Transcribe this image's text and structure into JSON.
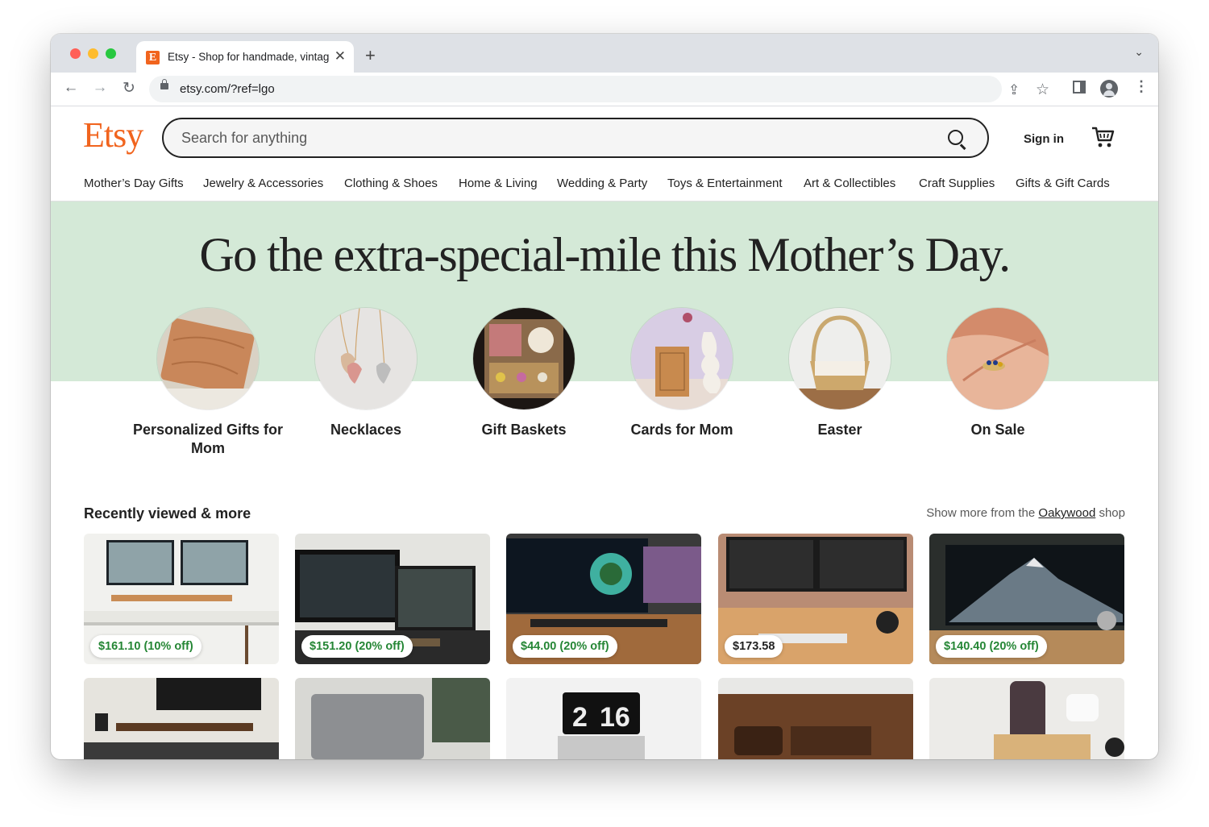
{
  "browser": {
    "tab_title": "Etsy - Shop for handmade, vintage",
    "favicon": "E",
    "url": "etsy.com/?ref=lgo"
  },
  "header": {
    "logo": "Etsy",
    "search_placeholder": "Search for anything",
    "sign_in": "Sign in"
  },
  "categories": [
    "Mother’s Day Gifts",
    "Jewelry & Accessories",
    "Clothing & Shoes",
    "Home & Living",
    "Wedding & Party",
    "Toys & Entertainment",
    "Art & Collectibles",
    "Craft Supplies",
    "Gifts & Gift Cards"
  ],
  "hero": {
    "title": "Go the extra-special-mile this Mother’s Day.",
    "circles": [
      {
        "label": "Personalized Gifts for Mom"
      },
      {
        "label": "Necklaces"
      },
      {
        "label": "Gift Baskets"
      },
      {
        "label": "Cards for Mom"
      },
      {
        "label": "Easter"
      },
      {
        "label": "On Sale"
      }
    ]
  },
  "recently_viewed": {
    "title": "Recently viewed & more",
    "more_prefix": "Show more from the",
    "shop_name": "Oakywood",
    "more_suffix": "shop",
    "prices": [
      "$161.10 (10% off)",
      "$151.20 (20% off)",
      "$44.00 (20% off)",
      "$173.58",
      "$140.40 (20% off)"
    ]
  },
  "colors": {
    "brand": "#f1641e",
    "hero_bg": "#d4e9d7",
    "sale_green": "#258635"
  }
}
